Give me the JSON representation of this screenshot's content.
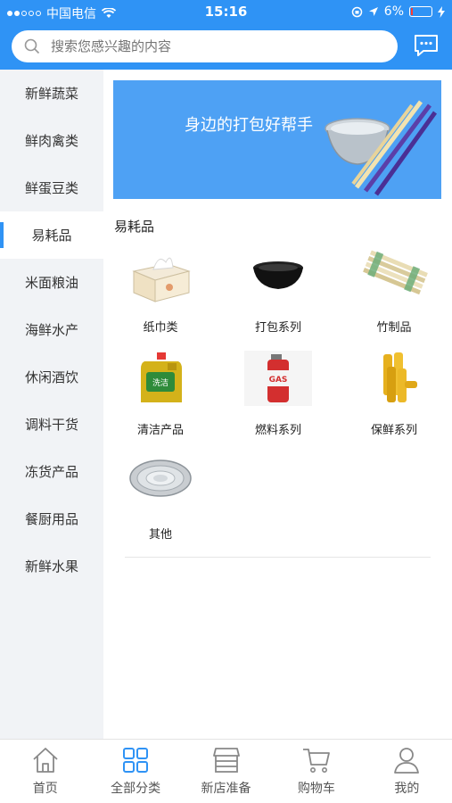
{
  "status": {
    "carrier": "中国电信",
    "time": "15:16",
    "battery": "6%"
  },
  "search": {
    "placeholder": "搜索您感兴趣的内容"
  },
  "sidebar": {
    "items": [
      {
        "label": "新鲜蔬菜"
      },
      {
        "label": "鲜肉禽类"
      },
      {
        "label": "鲜蛋豆类"
      },
      {
        "label": "易耗品"
      },
      {
        "label": "米面粮油"
      },
      {
        "label": "海鲜水产"
      },
      {
        "label": "休闲酒饮"
      },
      {
        "label": "调料干货"
      },
      {
        "label": "冻货产品"
      },
      {
        "label": "餐厨用品"
      },
      {
        "label": "新鲜水果"
      }
    ],
    "active_index": 3
  },
  "banner": {
    "text": "身边的打包好帮手"
  },
  "section": {
    "title": "易耗品",
    "products": [
      {
        "label": "纸巾类",
        "icon": "tissue-box-icon"
      },
      {
        "label": "打包系列",
        "icon": "takeout-bowl-icon"
      },
      {
        "label": "竹制品",
        "icon": "bamboo-chopsticks-icon"
      },
      {
        "label": "清洁产品",
        "icon": "detergent-bottle-icon"
      },
      {
        "label": "燃料系列",
        "icon": "gas-canister-icon"
      },
      {
        "label": "保鲜系列",
        "icon": "cling-film-icon"
      },
      {
        "label": "其他",
        "icon": "foil-tray-icon"
      }
    ]
  },
  "tabbar": {
    "tabs": [
      {
        "label": "首页",
        "icon": "home-icon"
      },
      {
        "label": "全部分类",
        "icon": "grid-icon"
      },
      {
        "label": "新店准备",
        "icon": "store-icon"
      },
      {
        "label": "购物车",
        "icon": "cart-icon"
      },
      {
        "label": "我的",
        "icon": "user-icon"
      }
    ],
    "active_index": 1
  },
  "colors": {
    "brand": "#2f93f5",
    "sidebar_bg": "#f1f3f6",
    "active_tab": "#2f93f5"
  }
}
